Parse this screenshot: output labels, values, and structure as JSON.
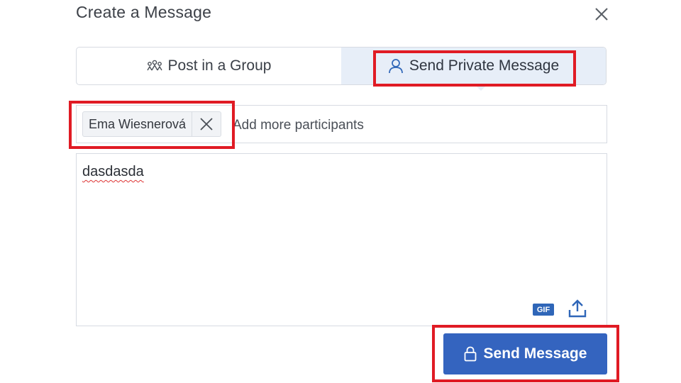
{
  "dialog": {
    "title": "Create a Message"
  },
  "tabs": [
    {
      "label": "Post in a Group",
      "icon": "group-icon",
      "active": false
    },
    {
      "label": "Send Private Message",
      "icon": "user-icon",
      "active": true
    }
  ],
  "participants": {
    "chips": [
      {
        "name": "Ema Wiesnerová"
      }
    ],
    "placeholder": "Add more participants"
  },
  "message": {
    "text": "dasdasda",
    "gif_label": "GIF"
  },
  "send_button": {
    "label": "Send Message",
    "icon": "lock-icon"
  },
  "colors": {
    "primary": "#3464bf",
    "active_tab_bg": "#e7eef8",
    "highlight": "#e01b24"
  }
}
